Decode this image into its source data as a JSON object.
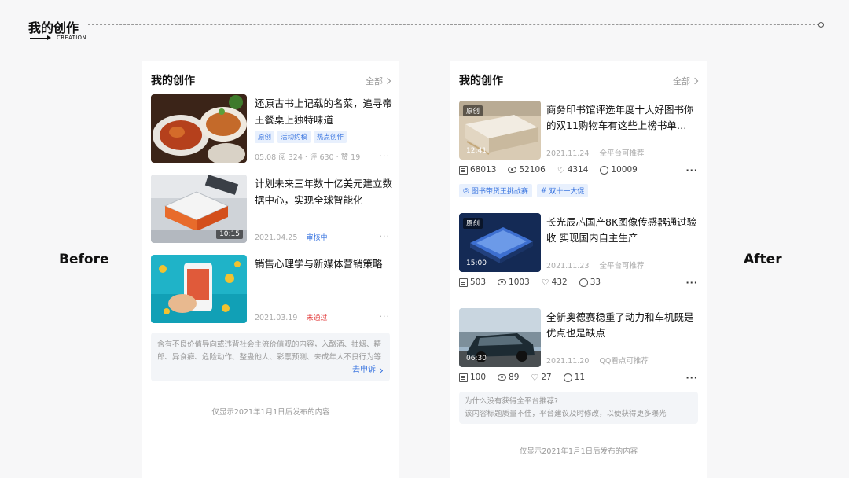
{
  "header": {
    "title": "我的创作",
    "subtitle": "CREATION"
  },
  "labels": {
    "before": "Before",
    "after": "After"
  },
  "before_panel": {
    "title": "我的创作",
    "all": "全部",
    "items": [
      {
        "title": "还原古书上记载的名菜，追寻帝王餐桌上独特味道",
        "tags": [
          "原创",
          "活动约稿",
          "热点创作"
        ],
        "meta": "05.08   阅 324 · 评 630 · 赞 19",
        "status": "",
        "duration": ""
      },
      {
        "title": "计划未来三年数十亿美元建立数据中心，实现全球智能化",
        "tags": [],
        "meta": "2021.04.25",
        "status": "审核中",
        "duration": "10:15"
      },
      {
        "title": "销售心理学与新媒体营销策略",
        "tags": [],
        "meta": "2021.03.19",
        "status": "未通过",
        "duration": ""
      }
    ],
    "notice": "含有不良价值导向或违背社会主流价值观的内容，入酗酒、抽烟、精郎、异食癖、危险动作、整蛊他人、彩票预测、未成年人不良行为等",
    "appeal": "去申诉",
    "footnote": "仅显示2021年1月1日后发布的内容"
  },
  "after_panel": {
    "title": "我的创作",
    "all": "全部",
    "items": [
      {
        "title": "商务印书馆评选年度十大好图书你的双11购物车有这些上榜书单…",
        "badge": "原创",
        "duration": "12:41",
        "date": "2021.11.24",
        "rec": "全平台可推荐",
        "stats": [
          "68013",
          "52106",
          "4314",
          "10009"
        ],
        "tags": [
          "图书带货王挑战赛",
          "双十一大促"
        ]
      },
      {
        "title": "长光辰芯国产8K图像传感器通过验收 实现国内自主生产",
        "badge": "原创",
        "duration": "15:00",
        "date": "2021.11.23",
        "rec": "全平台可推荐",
        "stats": [
          "503",
          "1003",
          "432",
          "33"
        ],
        "tags": []
      },
      {
        "title": "全新奥德赛稳重了动力和车机既是优点也是缺点",
        "badge": "",
        "duration": "06:30",
        "date": "2021.11.20",
        "rec": "QQ看点可推荐",
        "stats": [
          "100",
          "89",
          "27",
          "11"
        ],
        "tags": []
      }
    ],
    "why_title": "为什么没有获得全平台推荐?",
    "why_body": "该内容标题质量不佳，平台建议及时修改，以便获得更多曝光",
    "footnote": "仅显示2021年1月1日后发布的内容"
  },
  "colors": {
    "accent": "#3a75e0",
    "danger": "#e23b3b"
  },
  "icons": [
    "record-icon",
    "eye-icon",
    "heart-icon",
    "comment-icon",
    "hashtag-icon",
    "more-icon",
    "chevron-right-icon"
  ]
}
